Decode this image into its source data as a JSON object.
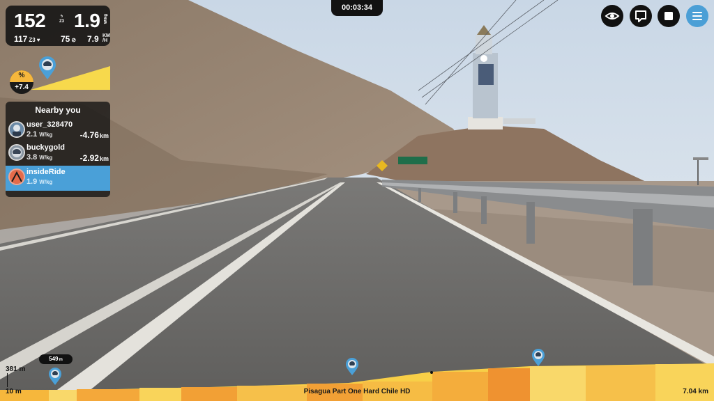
{
  "colors": {
    "accent": "#4aa0d8",
    "panel": "#121212",
    "gradient_yellow": "#f7d94c",
    "profile_orange": "#f6b73c"
  },
  "metrics": {
    "heart_rate": "152",
    "heart_zone": "Z3",
    "wkg": "1.9",
    "wkg_unit": "W/kg",
    "power": "117",
    "power_zone": "Z3",
    "cadence": "75",
    "speed": "7.9",
    "speed_unit": "KM/H"
  },
  "gradient": {
    "label": "%",
    "value": "+7.4"
  },
  "nearby": {
    "title": "Nearby you",
    "riders": [
      {
        "name": "user_328470",
        "wkg": "2.1",
        "wkg_unit": "W/kg",
        "gap": "-4.76",
        "gap_unit": "km",
        "avatar": "cyclist-avatar"
      },
      {
        "name": "buckygold",
        "wkg": "3.8",
        "wkg_unit": "W/kg",
        "gap": "-2.92",
        "gap_unit": "km",
        "avatar": "helmet-avatar"
      },
      {
        "name": "insideRide",
        "wkg": "1.9",
        "wkg_unit": "W/kg",
        "avatar": "brand-avatar"
      }
    ]
  },
  "timer": "00:03:34",
  "toolbar": {
    "icons": [
      "eye-icon",
      "chat-icon",
      "stop-icon",
      "menu-icon"
    ]
  },
  "profile": {
    "max_elevation": "381 m",
    "min_elevation": "10 m",
    "position": "549",
    "position_unit": "m",
    "route_name": "Pisagua Part One Hard Chile HD",
    "route_length": "7.04 km"
  }
}
